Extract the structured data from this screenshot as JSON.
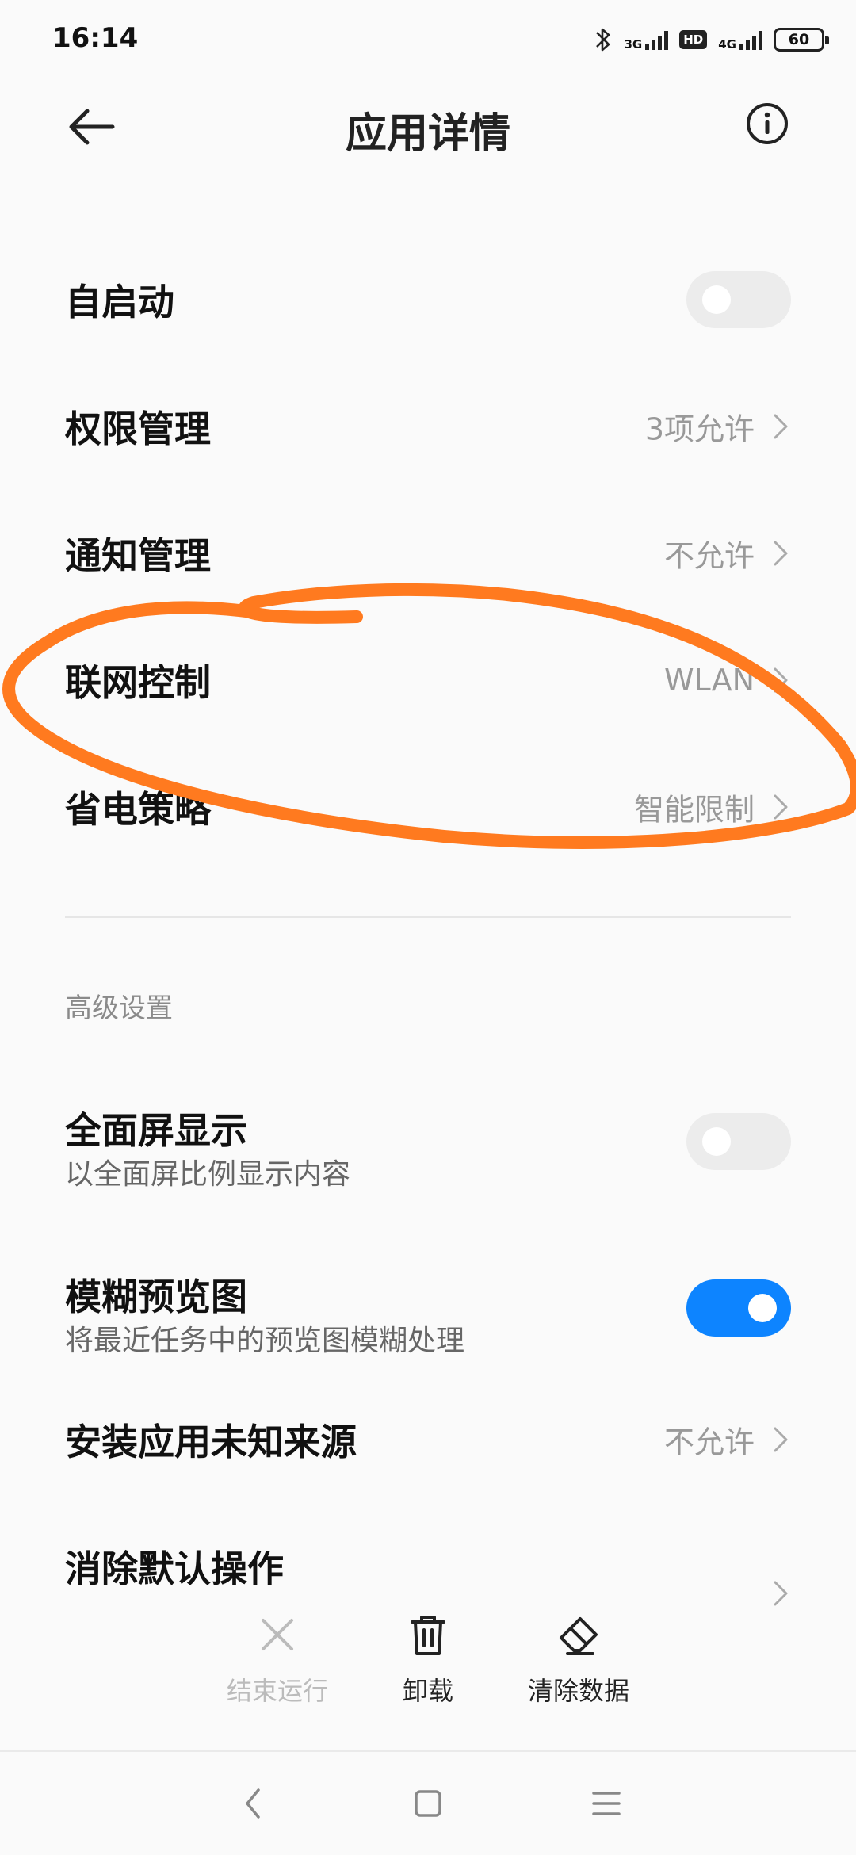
{
  "status_bar": {
    "time": "16:14",
    "network_1": "3G",
    "hd": "HD",
    "network_2": "4G",
    "battery": "60"
  },
  "header": {
    "title": "应用详情",
    "back_icon": "arrow-left-icon",
    "info_icon": "info-circle-icon"
  },
  "settings": {
    "autostart": {
      "label": "自启动",
      "toggle": false
    },
    "permissions": {
      "label": "权限管理",
      "value": "3项允许"
    },
    "notifications": {
      "label": "通知管理",
      "value": "不允许"
    },
    "network_control": {
      "label": "联网控制",
      "value": "WLAN"
    },
    "power_strategy": {
      "label": "省电策略",
      "value": "智能限制"
    }
  },
  "advanced": {
    "section_title": "高级设置",
    "fullscreen": {
      "label": "全面屏显示",
      "subtitle": "以全面屏比例显示内容",
      "toggle": false
    },
    "blur_preview": {
      "label": "模糊预览图",
      "subtitle": "将最近任务中的预览图模糊处理",
      "toggle": true
    },
    "unknown_sources": {
      "label": "安装应用未知来源",
      "value": "不允许"
    },
    "clear_defaults": {
      "label": "消除默认操作"
    }
  },
  "actions": {
    "force_stop": {
      "label": "结束运行",
      "icon": "close-x-icon",
      "enabled": false
    },
    "uninstall": {
      "label": "卸载",
      "icon": "trash-icon",
      "enabled": true
    },
    "clear_data": {
      "label": "清除数据",
      "icon": "eraser-icon",
      "enabled": true
    }
  },
  "nav": {
    "back": "nav-back-icon",
    "home": "nav-home-icon",
    "menu": "nav-menu-icon"
  },
  "colors": {
    "accent": "#0d84ff",
    "annotation": "#ff7a1f",
    "secondary_text": "#999999"
  }
}
